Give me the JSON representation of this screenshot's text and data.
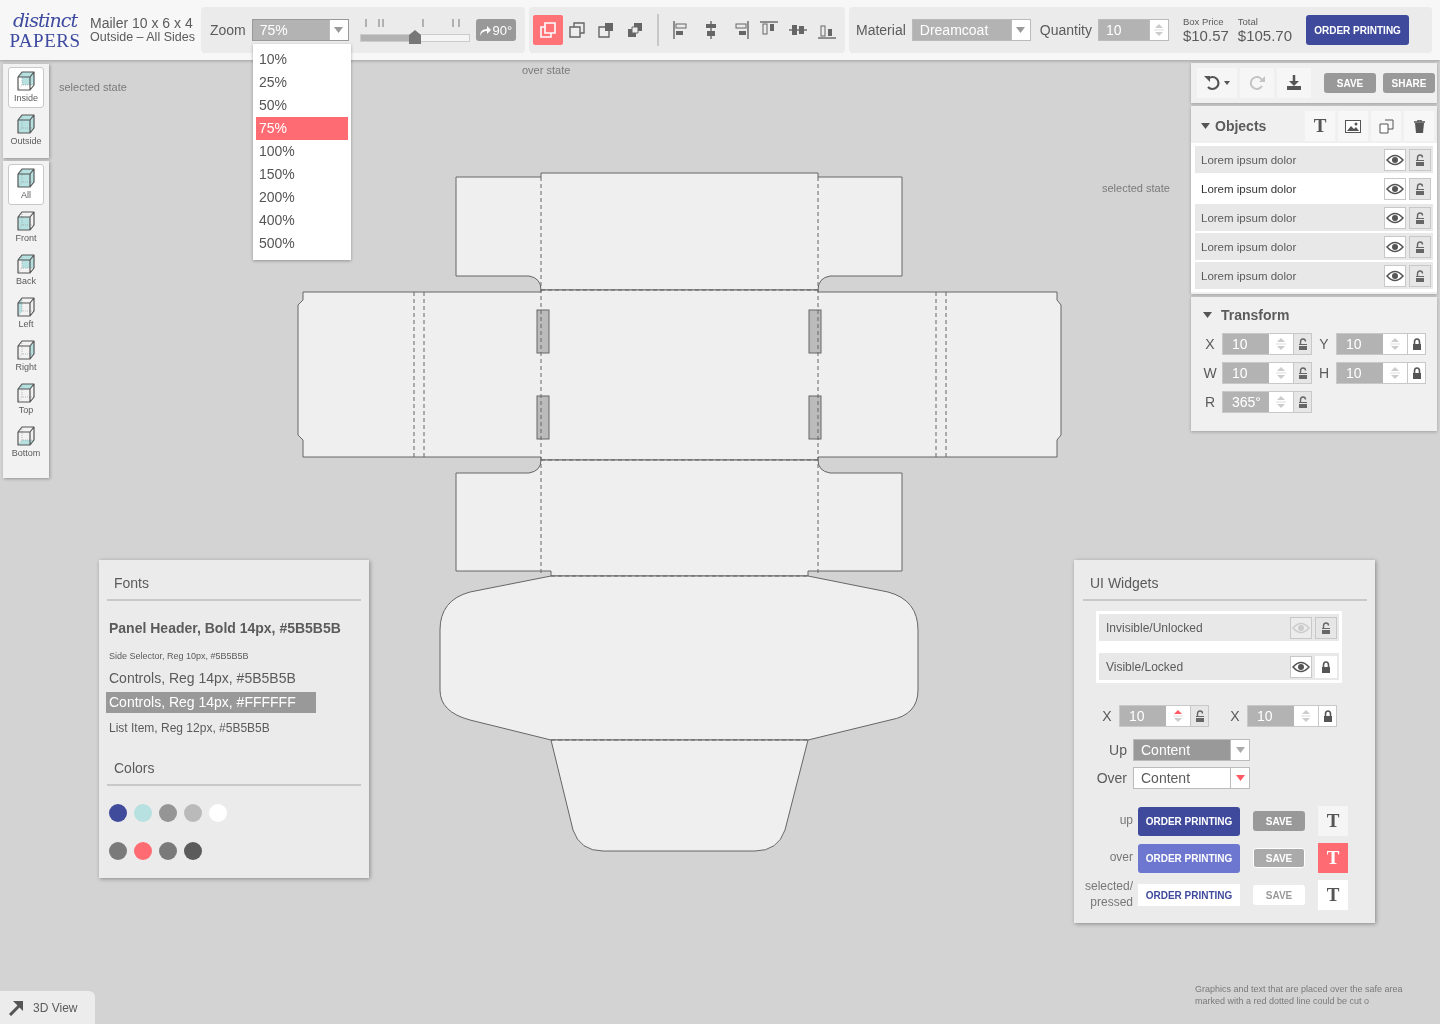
{
  "logo": {
    "script": "distinct",
    "wordmark": "PAPERS"
  },
  "product": {
    "title": "Mailer 10 x 6 x 4",
    "subtitle": "Outside – All Sides"
  },
  "zoom": {
    "label": "Zoom",
    "value": "75%",
    "expanded": true,
    "level": 0.5,
    "rotate": "90°",
    "options": [
      {
        "label": "10%",
        "selected": false
      },
      {
        "label": "25%",
        "selected": false
      },
      {
        "label": "50%",
        "selected": false
      },
      {
        "label": "75%",
        "selected": true
      },
      {
        "label": "100%",
        "selected": false
      },
      {
        "label": "150%",
        "selected": false
      },
      {
        "label": "200%",
        "selected": false
      },
      {
        "label": "400%",
        "selected": false
      },
      {
        "label": "500%",
        "selected": false
      }
    ]
  },
  "arrange_tools": [
    {
      "selected": true
    },
    {
      "selected": false
    },
    {
      "selected": false
    },
    {
      "selected": false
    }
  ],
  "material": {
    "label": "Material",
    "value": "Dreamcoat"
  },
  "quantity": {
    "label": "Quantity",
    "value": "10"
  },
  "box_price": {
    "label": "Box Price",
    "value": "$10.57"
  },
  "total": {
    "label": "Total",
    "value": "$105.70"
  },
  "order_button": "ORDER PRINTING",
  "annotations": [
    "selected state",
    "over state",
    "selected state"
  ],
  "side_selector": {
    "layers": [
      {
        "label": "Inside",
        "selected": true
      },
      {
        "label": "Outside",
        "selected": false
      }
    ],
    "faces": [
      {
        "label": "All",
        "selected": true
      },
      {
        "label": "Front",
        "selected": false
      },
      {
        "label": "Back",
        "selected": false
      },
      {
        "label": "Left",
        "selected": false
      },
      {
        "label": "Right",
        "selected": false
      },
      {
        "label": "Top",
        "selected": false
      },
      {
        "label": "Bottom",
        "selected": false
      }
    ]
  },
  "edit_toolbar": {
    "redo_disabled": true,
    "save": "SAVE",
    "share": "SHARE"
  },
  "objects": {
    "title": "Objects",
    "expanded": true,
    "text_tool": "T",
    "items": [
      {
        "label": "Lorem ipsum dolor",
        "selected": false,
        "visible": true,
        "locked": false
      },
      {
        "label": "Lorem ipsum dolor",
        "selected": true,
        "visible": true,
        "locked": false
      },
      {
        "label": "Lorem ipsum dolor",
        "selected": false,
        "visible": true,
        "locked": false
      },
      {
        "label": "Lorem ipsum dolor",
        "selected": false,
        "visible": true,
        "locked": false
      },
      {
        "label": "Lorem ipsum dolor",
        "selected": false,
        "visible": true,
        "locked": false
      }
    ]
  },
  "transform": {
    "title": "Transform",
    "expanded": true,
    "fields": [
      {
        "label": "X",
        "value": "10",
        "locked": false
      },
      {
        "label": "Y",
        "value": "10",
        "locked": true
      },
      {
        "label": "W",
        "value": "10",
        "locked": false
      },
      {
        "label": "H",
        "value": "10",
        "locked": true
      },
      {
        "label": "R",
        "value": "365°",
        "locked": false
      }
    ]
  },
  "fonts_panel": {
    "title": "Fonts",
    "samples": [
      {
        "kind": "header",
        "text": "Panel Header, Bold 14px,  #5B5B5B"
      },
      {
        "kind": "side",
        "text": "Side Selector, Reg 10px,  #5B5B5B"
      },
      {
        "kind": "control",
        "text": "Controls, Reg 14px,  #5B5B5B"
      },
      {
        "kind": "inverse",
        "text": "Controls, Reg 14px,  #FFFFFF"
      },
      {
        "kind": "list",
        "text": "List Item, Reg 12px,  #5B5B5B"
      }
    ],
    "colors_title": "Colors",
    "color_rows": [
      [
        {
          "color": "#404b9c"
        },
        {
          "color": "#b7e0e0"
        },
        {
          "color": "#959595"
        },
        {
          "color": "#bababa"
        },
        {
          "color": "#ffffff"
        }
      ],
      [
        {
          "color": "#7a7a7a"
        },
        {
          "color": "#ff6b73"
        },
        {
          "color": "#7a7a7a"
        },
        {
          "color": "#5b5b5b"
        }
      ]
    ]
  },
  "widgets_panel": {
    "title": "UI Widgets",
    "list": [
      {
        "label": "Invisible/Unlocked",
        "visible": false,
        "locked": false
      },
      {
        "label": "Visible/Locked",
        "visible": true,
        "locked": true
      }
    ],
    "spinners": [
      {
        "label": "X",
        "value": "10",
        "locked": false,
        "hover": true
      },
      {
        "label": "X",
        "value": "10",
        "locked": true,
        "hover": false
      }
    ],
    "dropdowns": [
      {
        "label": "Up",
        "value": "Content",
        "hover": false
      },
      {
        "label": "Over",
        "value": "Content",
        "hover": true
      }
    ],
    "button_rows": [
      {
        "label": "up",
        "kind": "normal",
        "order": "ORDER PRINTING",
        "save": "SAVE",
        "tool": "T"
      },
      {
        "label": "over",
        "kind": "hover",
        "order": "ORDER PRINTING",
        "save": "SAVE",
        "tool": "T"
      },
      {
        "label": "selected/ pressed",
        "kind": "pressed",
        "order": "ORDER PRINTING",
        "save": "SAVE",
        "tool": "T"
      }
    ]
  },
  "view_3d": "3D View",
  "footnote": "Graphics and text that are placed over the safe area marked with a red dotted line could be cut o"
}
